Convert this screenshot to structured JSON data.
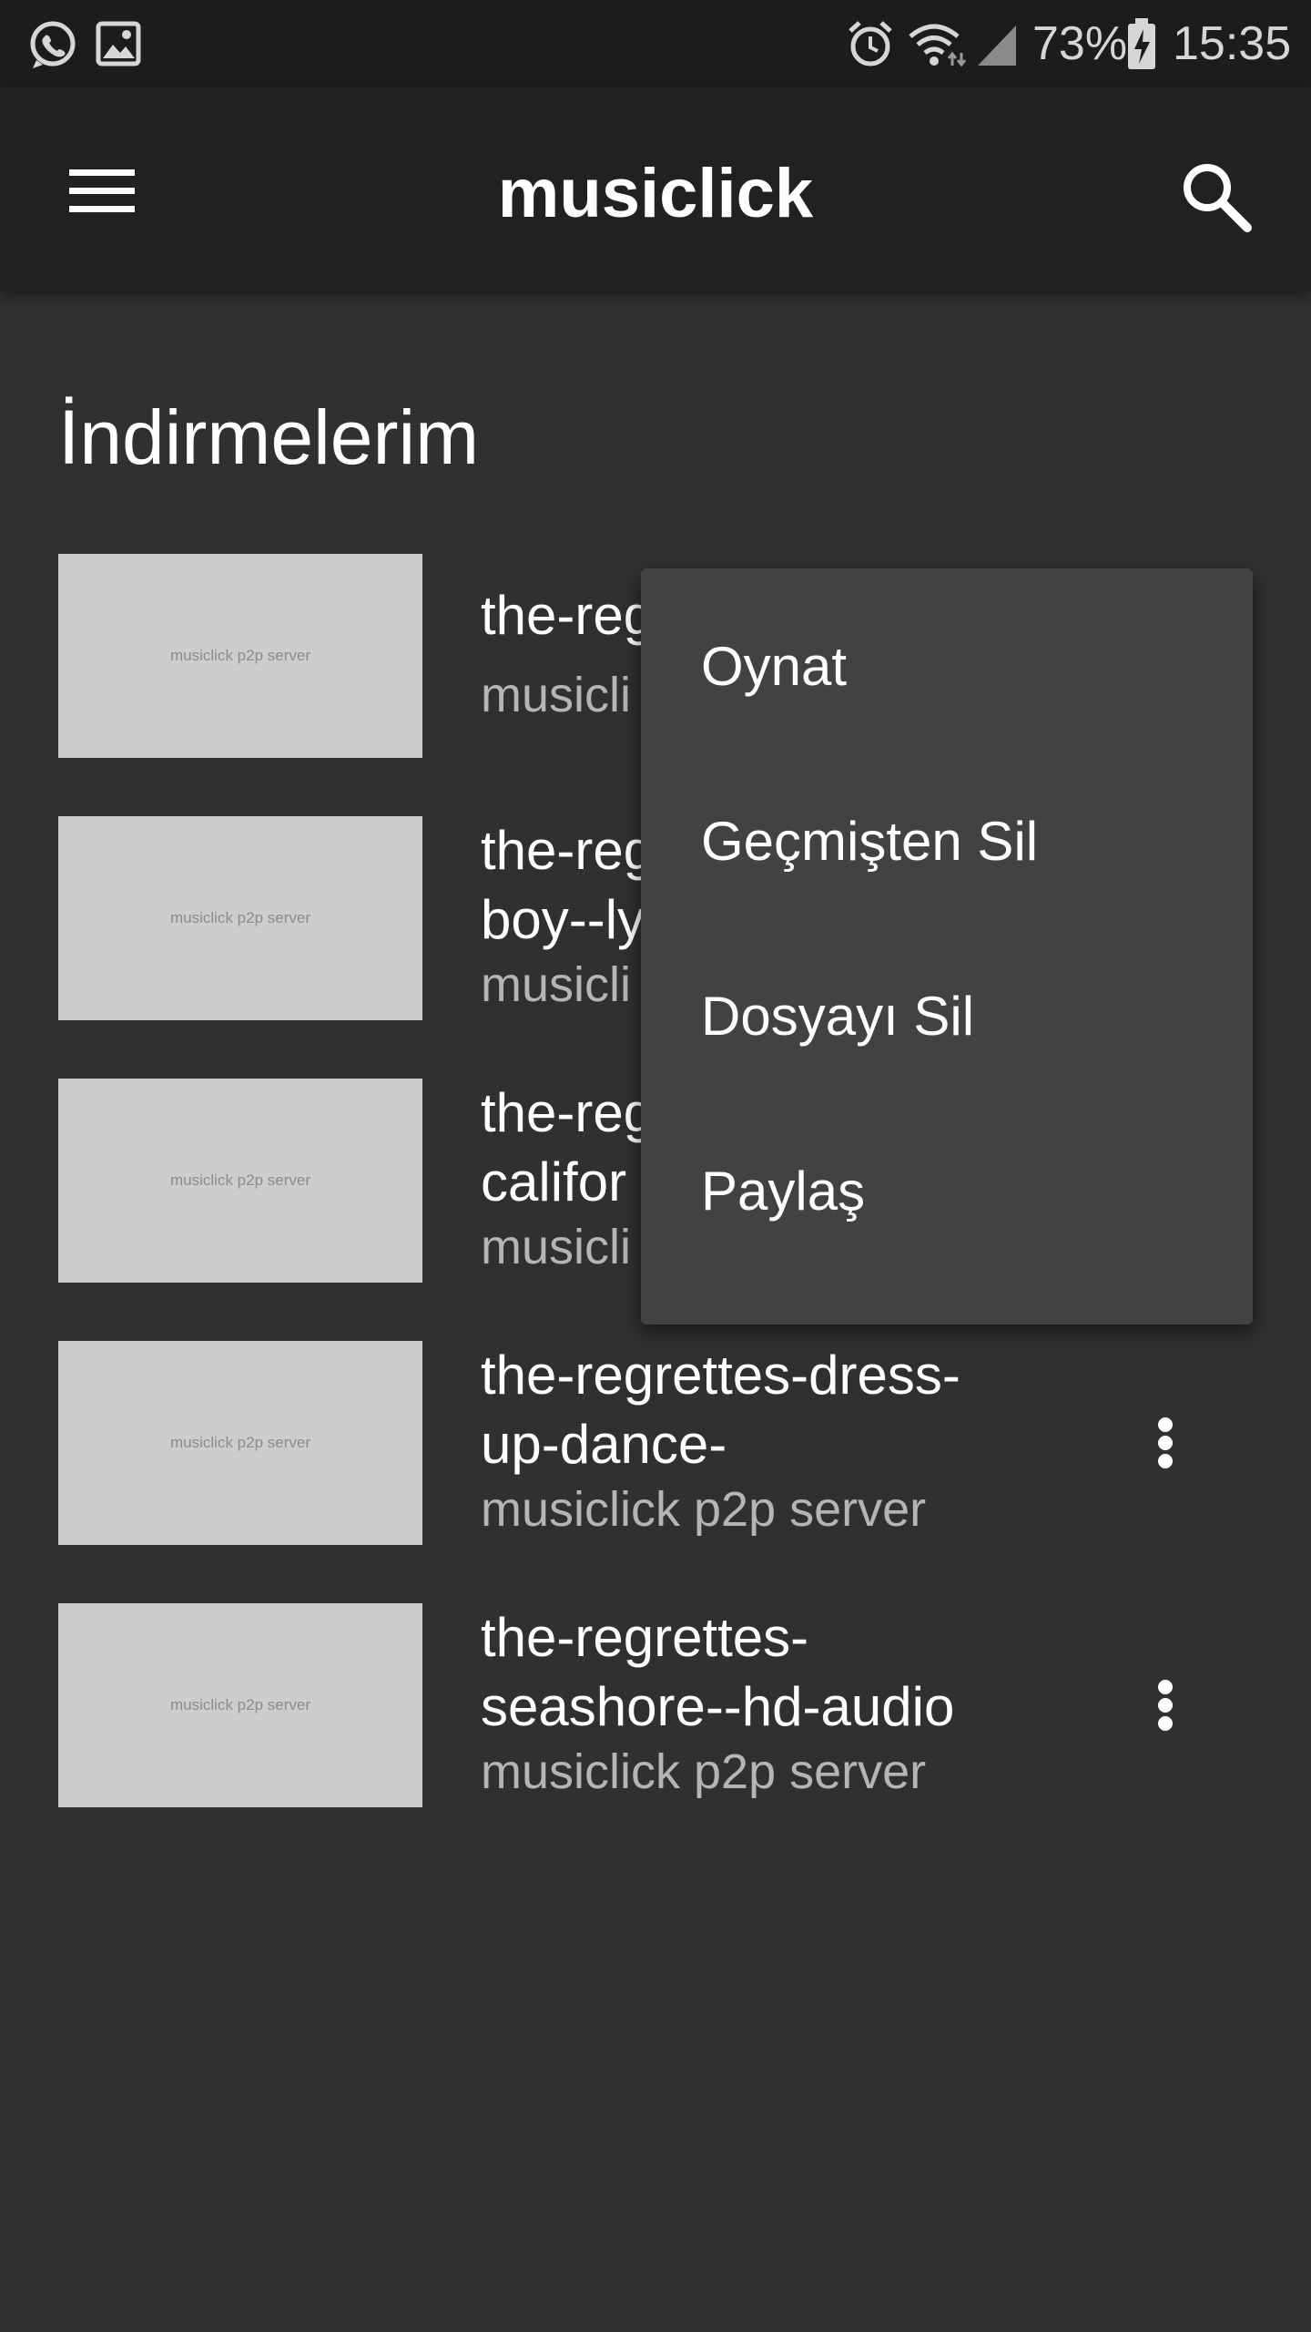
{
  "status_bar": {
    "battery_percent": "73%",
    "time": "15:35",
    "left_icons": [
      "whatsapp-icon",
      "image-icon"
    ],
    "right_icons": [
      "alarm-icon",
      "wifi-icon",
      "signal-icon",
      "battery-charging-icon"
    ]
  },
  "app_bar": {
    "title": "musiclick",
    "menu_icon": "menu-icon",
    "search_icon": "search-icon"
  },
  "section": {
    "title": "İndirmelerim"
  },
  "thumbnail_text": "musiclick p2p server",
  "tracks": [
    {
      "title": "the-reg",
      "subtitle": "musicli"
    },
    {
      "title": "the-reg\nboy--ly",
      "subtitle": "musicli"
    },
    {
      "title": "the-reg\ncalifor",
      "subtitle": "musicli"
    },
    {
      "title": "the-regrettes-dress-\nup-dance-",
      "subtitle": "musiclick p2p server"
    },
    {
      "title": "the-regrettes-\nseashore--hd-audio",
      "subtitle": "musiclick p2p server"
    }
  ],
  "popup_menu": {
    "items": [
      "Oynat",
      "Geçmişten Sil",
      "Dosyayı Sil",
      "Paylaş"
    ]
  },
  "colors": {
    "background": "#303030",
    "status_bar": "#1c1c1c",
    "app_bar": "#212121",
    "popup": "#424242",
    "thumbnail": "#cdcdcd"
  }
}
